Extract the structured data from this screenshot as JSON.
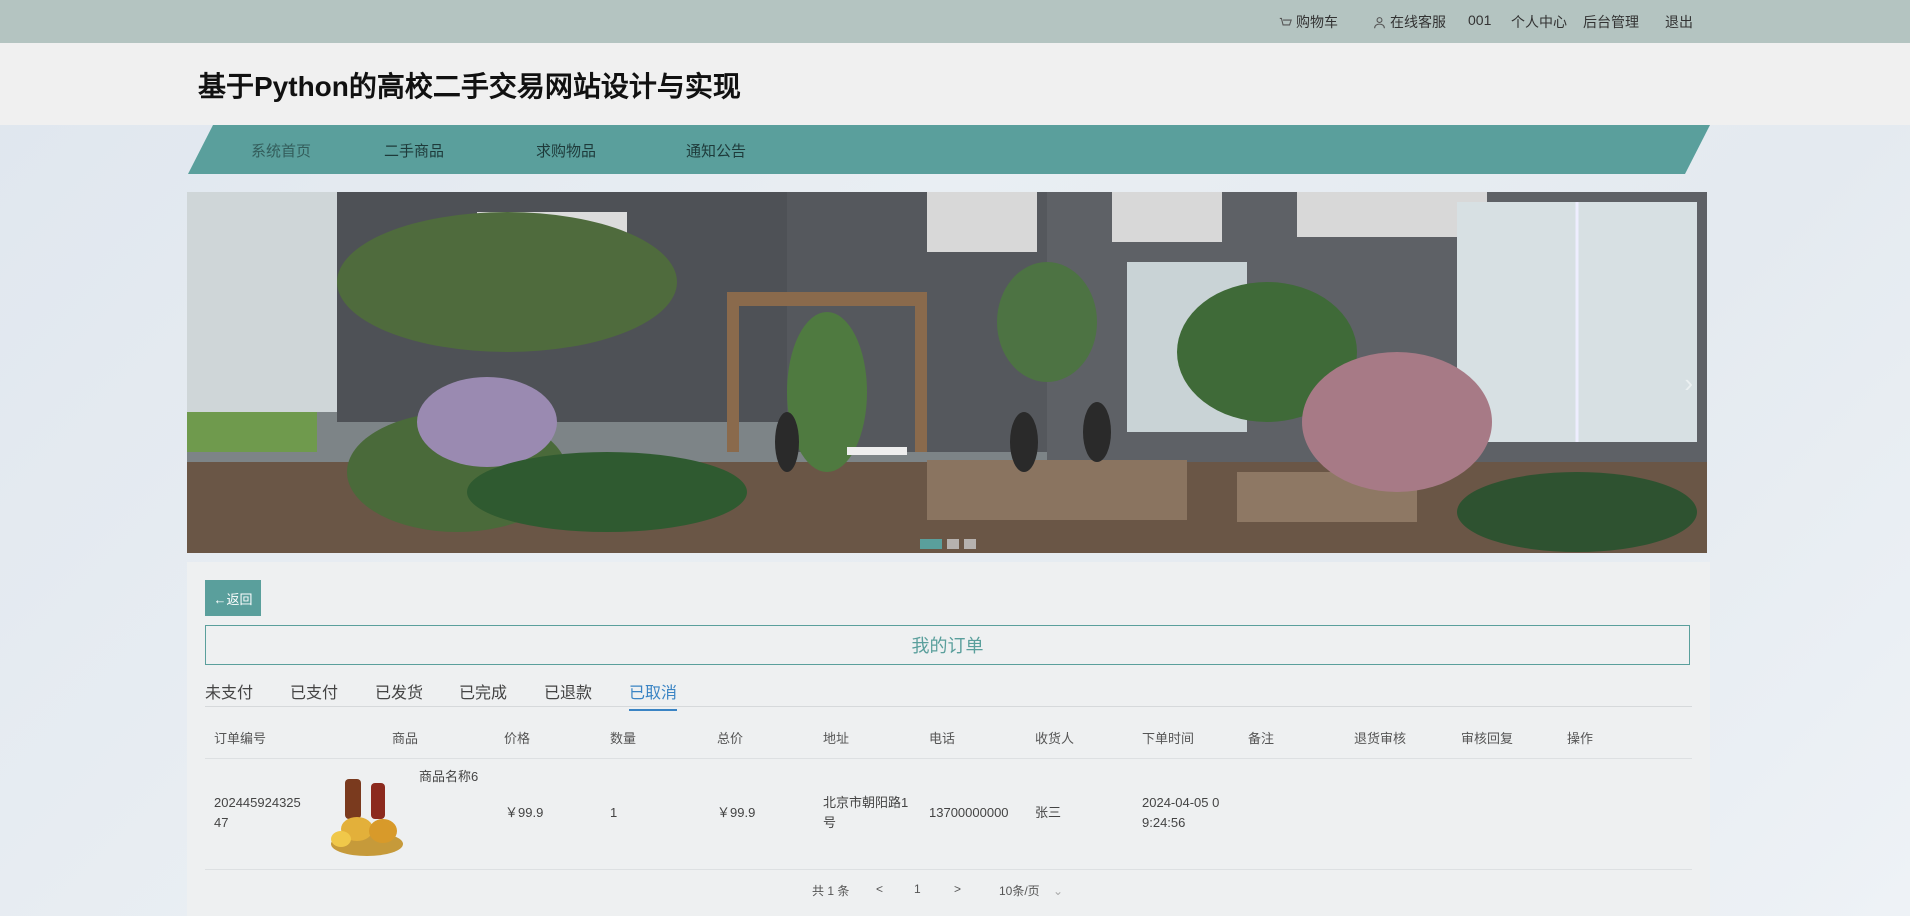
{
  "topbar": {
    "cart": "购物车",
    "service": "在线客服",
    "user": "001",
    "profile": "个人中心",
    "admin": "后台管理",
    "logout": "退出"
  },
  "header": {
    "title": "基于Python的高校二手交易网站设计与实现"
  },
  "nav": [
    "系统首页",
    "二手商品",
    "求购物品",
    "通知公告"
  ],
  "carousel": {
    "slide_count": 3,
    "active_index": 0
  },
  "page": {
    "back_label": "←返回",
    "title": "我的订单"
  },
  "tabs": {
    "items": [
      "未支付",
      "已支付",
      "已发货",
      "已完成",
      "已退款",
      "已取消"
    ],
    "active": "已取消"
  },
  "table": {
    "headers": [
      "订单编号",
      "商品",
      "价格",
      "数量",
      "总价",
      "地址",
      "电话",
      "收货人",
      "下单时间",
      "备注",
      "退货审核",
      "审核回复",
      "操作"
    ],
    "rows": [
      {
        "order_no_l1": "202445924325",
        "order_no_l2": "47",
        "product_name": "商品名称6",
        "price": "￥99.9",
        "quantity": "1",
        "total": "￥99.9",
        "address_l1": "北京市朝阳路1",
        "address_l2": "号",
        "phone": "13700000000",
        "receiver": "张三",
        "time_l1": "2024-04-05 0",
        "time_l2": "9:24:56"
      }
    ]
  },
  "pagination": {
    "total": "共 1 条",
    "prev": "<",
    "page": "1",
    "next": ">",
    "page_size": "10条/页"
  },
  "colors": {
    "accent": "#5a9f9c",
    "active_tab": "#3a84c4",
    "topbar": "#b4c4c1"
  }
}
